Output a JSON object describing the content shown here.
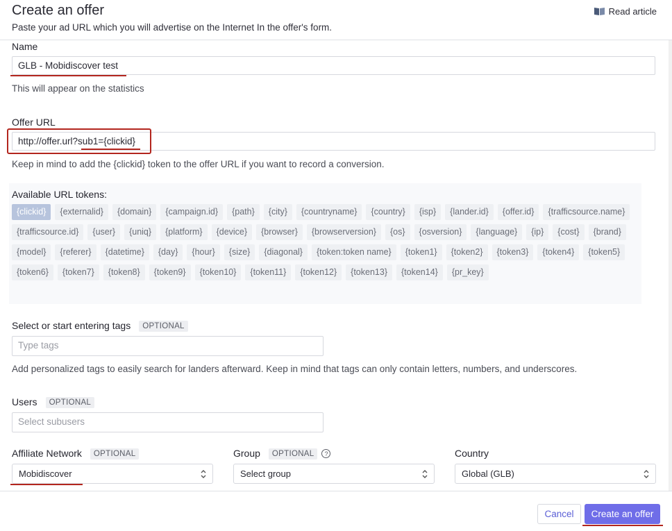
{
  "header": {
    "title": "Create an offer",
    "subtitle": "Paste your ad URL which you will advertise on the Internet In the offer's form.",
    "read_article": "Read article"
  },
  "name": {
    "label": "Name",
    "value": "GLB - Mobidiscover test",
    "hint": "This will appear on the statistics"
  },
  "offer_url": {
    "label": "Offer URL",
    "value": "http://offer.url?sub1={clickid}",
    "hint": "Keep in mind to add the {clickid} token to the offer URL if you want to record a conversion."
  },
  "url_tokens": {
    "title": "Available URL tokens:",
    "active": "{clickid}",
    "items": [
      "{clickid}",
      "{externalid}",
      "{domain}",
      "{campaign.id}",
      "{path}",
      "{city}",
      "{countryname}",
      "{country}",
      "{isp}",
      "{lander.id}",
      "{offer.id}",
      "{trafficsource.name}",
      "{trafficsource.id}",
      "{user}",
      "{uniq}",
      "{platform}",
      "{device}",
      "{browser}",
      "{browserversion}",
      "{os}",
      "{osversion}",
      "{language}",
      "{ip}",
      "{cost}",
      "{brand}",
      "{model}",
      "{referer}",
      "{datetime}",
      "{day}",
      "{hour}",
      "{size}",
      "{diagonal}",
      "{token:token name}",
      "{token1}",
      "{token2}",
      "{token3}",
      "{token4}",
      "{token5}",
      "{token6}",
      "{token7}",
      "{token8}",
      "{token9}",
      "{token10}",
      "{token11}",
      "{token12}",
      "{token13}",
      "{token14}",
      "{pr_key}"
    ]
  },
  "tags": {
    "label": "Select or start entering tags",
    "optional": "OPTIONAL",
    "placeholder": "Type tags",
    "hint": "Add personalized tags to easily search for landers afterward. Keep in mind that tags can only contain letters, numbers, and underscores."
  },
  "users": {
    "label": "Users",
    "optional": "OPTIONAL",
    "placeholder": "Select subusers"
  },
  "affiliate_network": {
    "label": "Affiliate Network",
    "optional": "OPTIONAL",
    "value": "Mobidiscover"
  },
  "group": {
    "label": "Group",
    "optional": "OPTIONAL",
    "help": "?",
    "value": "Select group"
  },
  "country": {
    "label": "Country",
    "value": "Global (GLB)"
  },
  "footer": {
    "cancel": "Cancel",
    "create": "Create an offer"
  },
  "colors": {
    "accent": "#6f6de8",
    "annotation": "#b3261e",
    "token_active": "#b7c4dd"
  }
}
